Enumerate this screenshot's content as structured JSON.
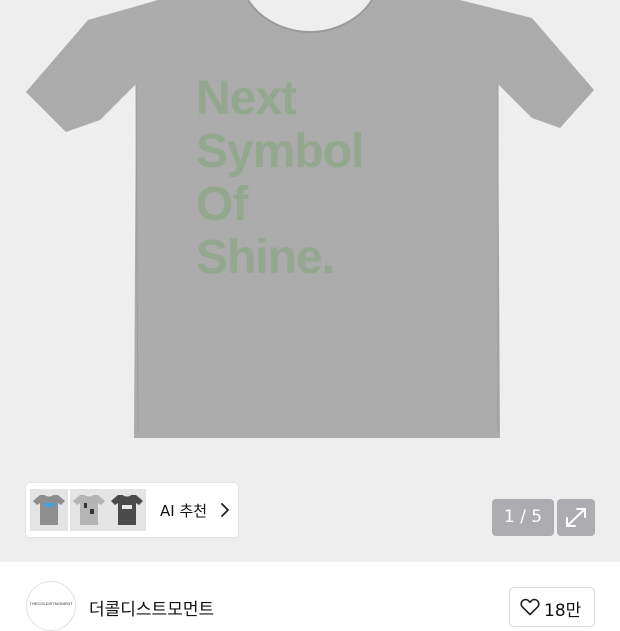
{
  "product": {
    "shirt_print_lines": [
      "Next",
      "Symbol",
      "Of",
      "Shine."
    ],
    "shirt_color": "#a8a8a8",
    "print_color": "#8fa88a"
  },
  "ai_recommend": {
    "label": "AI 추천",
    "chevron_icon": "chevron-right-icon",
    "thumbnails": [
      "gray-tshirt-blue-print",
      "gray-tshirt-black-print",
      "charcoal-tshirt-white-print"
    ]
  },
  "gallery": {
    "counter": "1 / 5",
    "expand_icon": "expand-diagonal-icon"
  },
  "shop": {
    "logo_text": "THECOLDISTMOMENT",
    "name": "더콜디스트모먼트",
    "like_icon": "heart-outline-icon",
    "like_count": "18만"
  }
}
